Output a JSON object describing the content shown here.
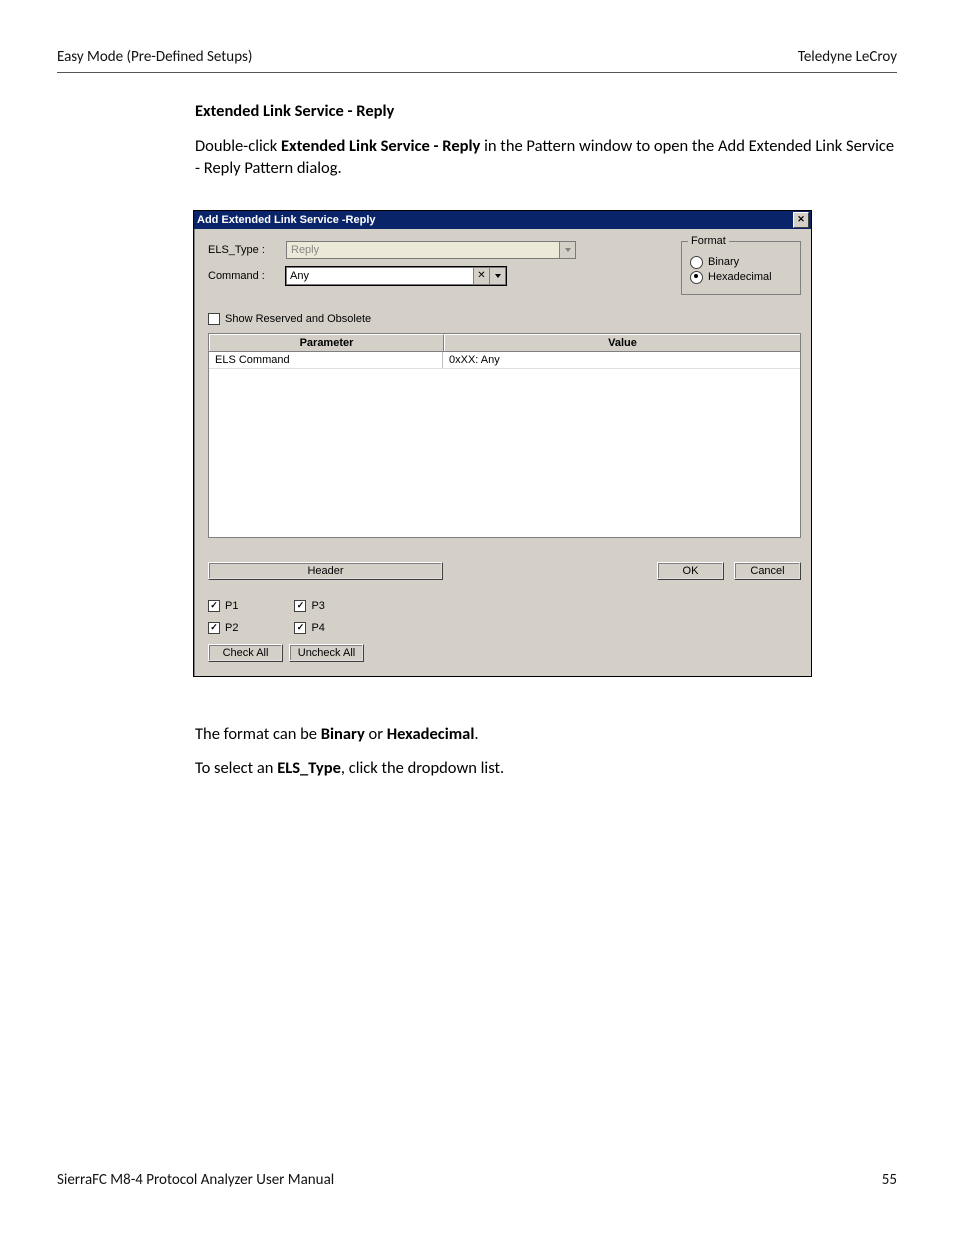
{
  "header": {
    "left": "Easy Mode (Pre-Defined Setups)",
    "right": "Teledyne  LeCroy"
  },
  "section": {
    "title": "Extended Link Service - Reply",
    "intro_pre": "Double-click ",
    "intro_bold": "Extended Link Service - Reply",
    "intro_post": " in the Pattern window to open the Add Extended Link Service - Reply  Pattern dialog."
  },
  "dialog": {
    "title": "Add Extended Link Service -Reply",
    "els_type_label": "ELS_Type :",
    "els_type_value": "Reply",
    "command_label": "Command :",
    "command_value": "Any",
    "format": {
      "legend": "Format",
      "binary": "Binary",
      "hex": "Hexadecimal"
    },
    "show_reserved": "Show Reserved and Obsolete",
    "table": {
      "col1": "Parameter",
      "col2": "Value",
      "row1_param": "ELS Command",
      "row1_value": "0xXX: Any"
    },
    "header_btn": "Header",
    "ok": "OK",
    "cancel": "Cancel",
    "p1": "P1",
    "p2": "P2",
    "p3": "P3",
    "p4": "P4",
    "check_all": "Check All",
    "uncheck_all": "Uncheck All"
  },
  "post": {
    "line1_pre": "The format can be ",
    "line1_b1": "Binary",
    "line1_mid": " or ",
    "line1_b2": "Hexadecimal",
    "line1_post": ".",
    "line2_pre": "To select an ",
    "line2_b": "ELS_Type",
    "line2_post": ", click the dropdown list."
  },
  "footer": {
    "left": "SierraFC M8-4 Protocol Analyzer User Manual",
    "right": "55"
  }
}
